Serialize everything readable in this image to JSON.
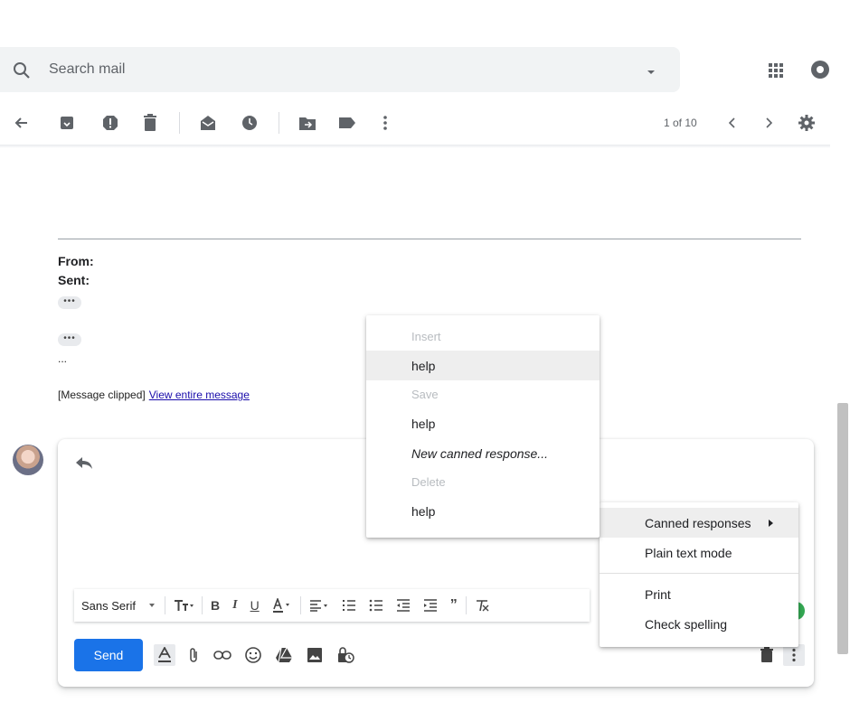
{
  "search": {
    "placeholder": "Search mail"
  },
  "toolbar": {
    "pager": "1 of 10"
  },
  "message": {
    "from_label": "From:",
    "sent_label": "Sent:",
    "dots": "•••",
    "ellipsis": "...",
    "clipped_text": "[Message clipped]",
    "view_entire_link": "View entire message"
  },
  "canned_menu": {
    "insert_header": "Insert",
    "insert_item": "help",
    "save_header": "Save",
    "save_item": "help",
    "new_response": "New canned response...",
    "delete_header": "Delete",
    "delete_item": "help"
  },
  "more_menu": {
    "canned_responses": "Canned responses",
    "plain_text": "Plain text mode",
    "print": "Print",
    "check_spelling": "Check spelling"
  },
  "compose": {
    "font_select": "Sans Serif",
    "send_label": "Send"
  },
  "colors": {
    "accent": "#1a73e8",
    "link": "#1a0dab",
    "menu_hover": "#eeeeee",
    "search_bg": "#f1f3f4"
  }
}
